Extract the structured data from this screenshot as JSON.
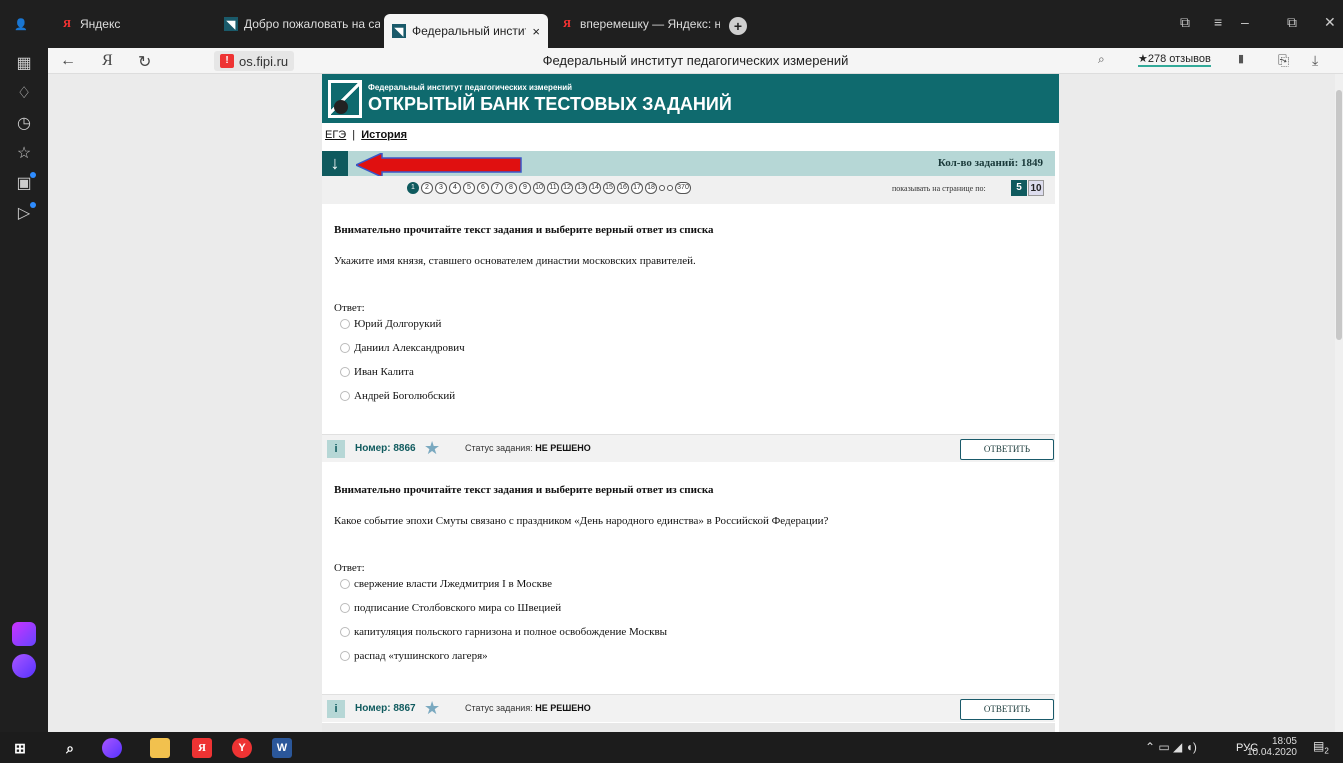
{
  "browser": {
    "tabs": [
      {
        "label": "Яндекс",
        "icon": "yandex-icon"
      },
      {
        "label": "Добро пожаловать на сай",
        "icon": "fipi-icon"
      },
      {
        "label": "Федеральный институт",
        "icon": "fipi-icon",
        "active": true
      },
      {
        "label": "вперемешку — Яндекс: на",
        "icon": "yandex-icon"
      }
    ],
    "host": "os.fipi.ru",
    "page_title": "Федеральный институт педагогических измерений",
    "reviews": "★278 отзывов"
  },
  "header": {
    "org": "Федеральный институт педагогических измерений",
    "bank": "ОТКРЫТЫЙ БАНК ТЕСТОВЫХ ЗАДАНИЙ"
  },
  "breadcrumb": {
    "exam": "ЕГЭ",
    "sep": "|",
    "subject": "История"
  },
  "infobar": {
    "count": "Кол-во заданий: 1849",
    "down_icon": "arrow-down-icon"
  },
  "pager": {
    "pages": [
      "1",
      "2",
      "3",
      "4",
      "5",
      "6",
      "7",
      "8",
      "9",
      "10",
      "11",
      "12",
      "13",
      "14",
      "15",
      "16",
      "17",
      "18",
      "",
      "",
      "370"
    ],
    "current": "1",
    "per_page_label": "показывать на странице по:",
    "per_page_options": [
      "5",
      "10"
    ],
    "per_page_selected": "5"
  },
  "tasks": [
    {
      "heading": "Внимательно прочитайте текст задания и выберите верный ответ из списка",
      "question": "Укажите имя князя, ставшего основателем династии московских правителей.",
      "answer_label": "Ответ:",
      "options": [
        "Юрий Долгорукий",
        "Даниил Александрович",
        "Иван Калита",
        "Андрей Боголюбский"
      ],
      "info": "i",
      "number": "Номер: 8866",
      "status_label": "Статус задания:",
      "status": "НЕ РЕШЕНО",
      "button": "ОТВЕТИТЬ"
    },
    {
      "heading": "Внимательно прочитайте текст задания и выберите верный ответ из списка",
      "question": "Какое событие эпохи Смуты связано с праздником «День народного единства» в Российской Федерации?",
      "answer_label": "Ответ:",
      "options": [
        "свержение власти Лжедмитрия I в Москве",
        "подписание Столбовского мира со Швецией",
        "капитуляция польского гарнизона и полное освобождение Москвы",
        "распад «тушинского лагеря»"
      ],
      "info": "i",
      "number": "Номер: 8867",
      "status_label": "Статус задания:",
      "status": "НЕ РЕШЕНО",
      "button": "ОТВЕТИТЬ"
    }
  ],
  "taskbar": {
    "time": "18:05",
    "date": "10.04.2020",
    "lang": "РУС",
    "notifications": "2"
  },
  "colors": {
    "brand": "#0f6a6e",
    "infobar": "#b6d7d6",
    "annotation_arrow": "#e01010"
  }
}
